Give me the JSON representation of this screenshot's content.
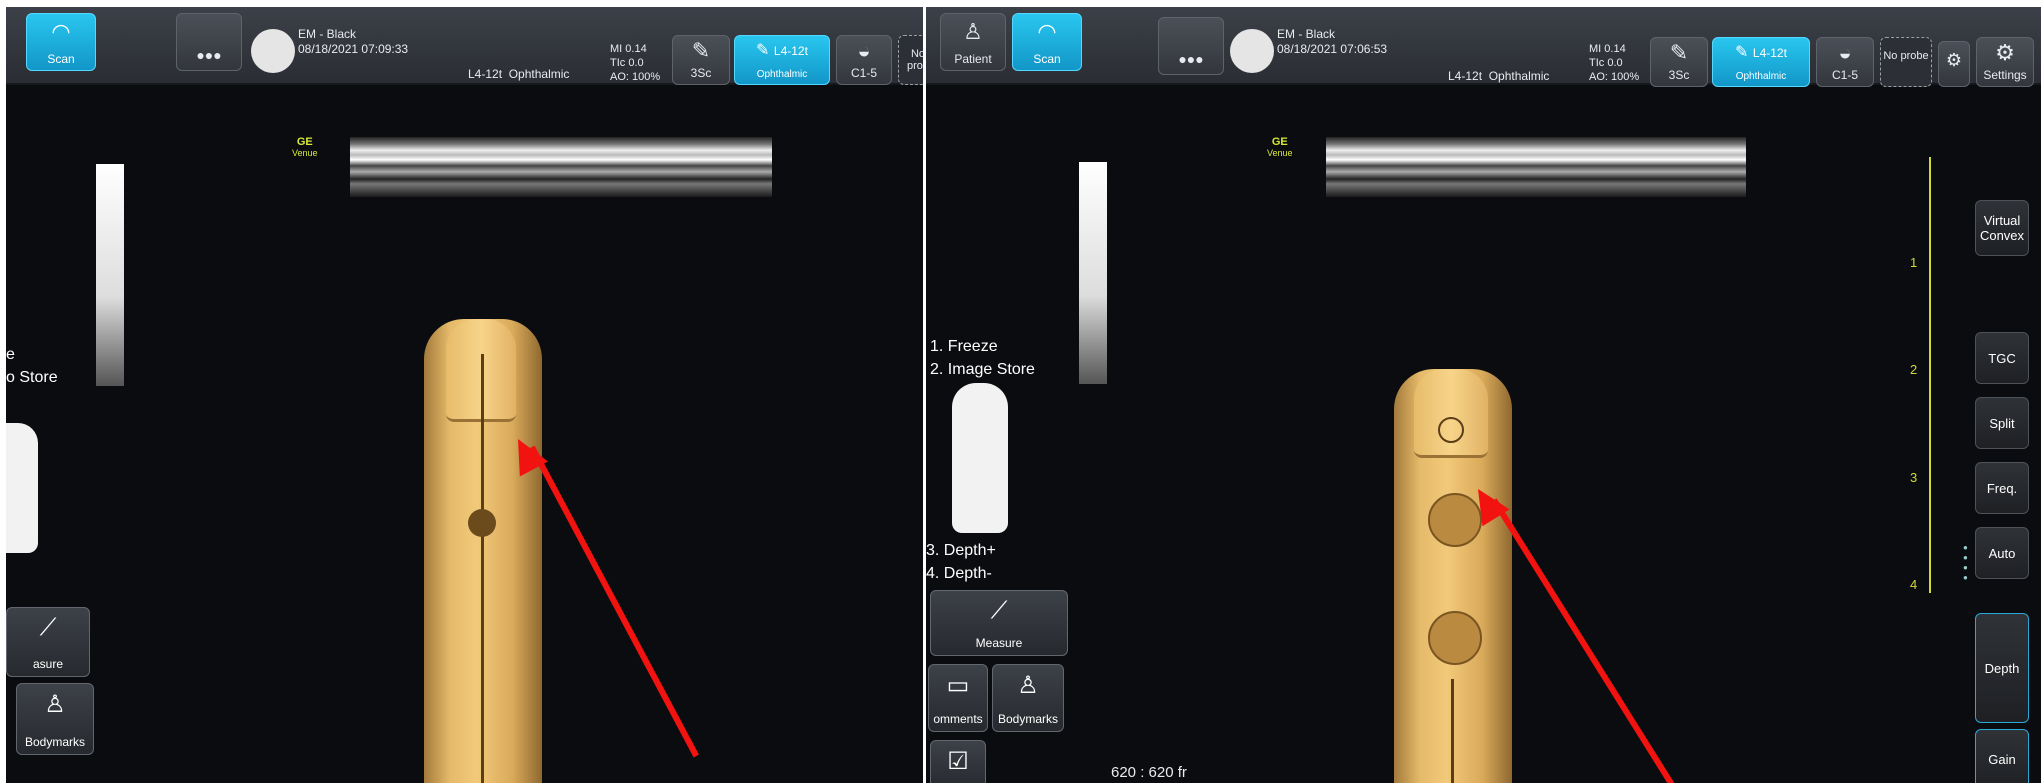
{
  "left": {
    "header": {
      "scan_label": "Scan",
      "patient_name": "EM - Black",
      "datetime": "08/18/2021 07:09:33",
      "probe_name": "L4-12t",
      "preset": "Ophthalmic",
      "mi": "MI 0.14",
      "tic": "TIc 0.0",
      "ao": "AO: 100%",
      "probe_buttons": [
        {
          "label": "3Sc"
        },
        {
          "label": "L4-12t",
          "sub": "Ophthalmic"
        },
        {
          "label": "C1-5"
        },
        {
          "label": "No prob"
        }
      ]
    },
    "logo": {
      "brand": "GE",
      "model": "Venue"
    },
    "menu_items": [
      "e",
      "o Store"
    ],
    "bottom_buttons": [
      {
        "label": "asure",
        "icon": "measure-icon"
      },
      {
        "label": "Bodymarks",
        "icon": "bodymarks-icon"
      }
    ]
  },
  "right": {
    "header": {
      "patient_label": "Patient",
      "scan_label": "Scan",
      "patient_name": "EM - Black",
      "datetime": "08/18/2021 07:06:53",
      "probe_name": "L4-12t",
      "preset": "Ophthalmic",
      "mi": "MI 0.14",
      "tic": "TIc 0.0",
      "ao": "AO: 100%",
      "probe_buttons": [
        {
          "label": "3Sc"
        },
        {
          "label": "L4-12t",
          "sub": "Ophthalmic"
        },
        {
          "label": "C1-5"
        },
        {
          "label": "No probe"
        }
      ],
      "settings_label": "Settings"
    },
    "logo": {
      "brand": "GE",
      "model": "Venue"
    },
    "menu_items": [
      "1. Freeze",
      "2. Image Store",
      "3. Depth+",
      "4. Depth-"
    ],
    "bottom_buttons": [
      {
        "label": "Measure",
        "icon": "measure-icon"
      },
      {
        "label": "omments",
        "icon": "comments-icon"
      },
      {
        "label": "Bodymarks",
        "icon": "bodymarks-icon"
      }
    ],
    "frame_counter": "620 : 620 fr",
    "depth_scale": [
      "1",
      "2",
      "3",
      "4"
    ],
    "side_buttons": [
      "Virtual Convex",
      "TGC",
      "Split",
      "Freq.",
      "Auto",
      "Depth",
      "Gain"
    ]
  }
}
